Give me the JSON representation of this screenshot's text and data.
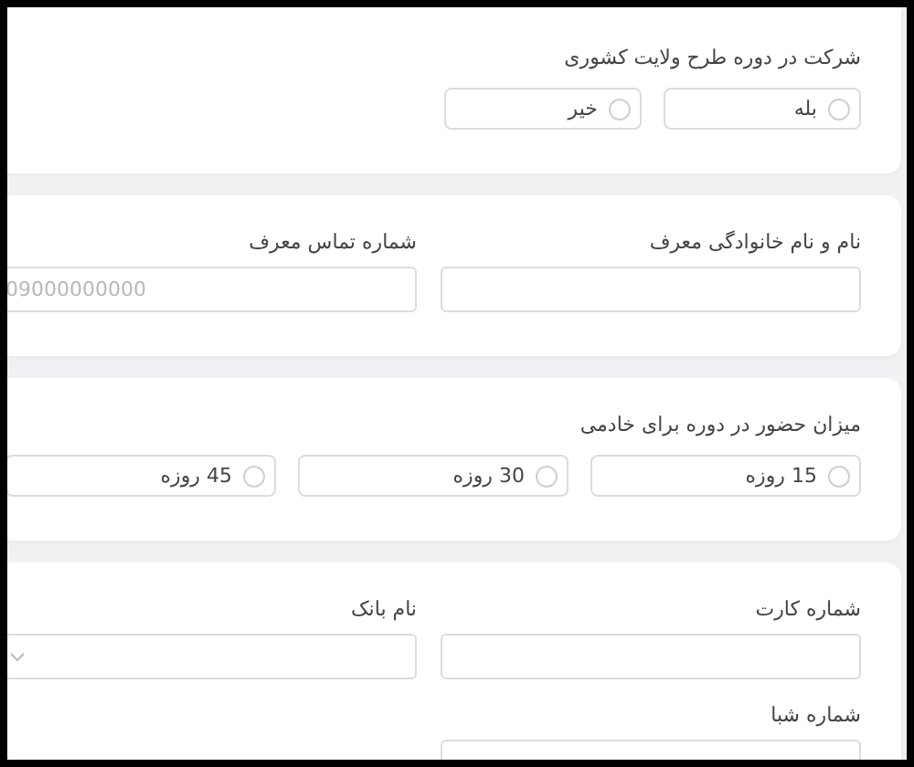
{
  "cards": [
    {
      "kind": "radio",
      "question": "شرکت در دوره طرح ولایت کشوری",
      "options": [
        {
          "label": "بله",
          "selected": false
        },
        {
          "label": "خیر",
          "selected": false
        }
      ]
    },
    {
      "kind": "fields",
      "fields": [
        {
          "kind": "text",
          "label": "نام و نام خانوادگی معرف"
        },
        {
          "kind": "text",
          "label": "شماره تماس معرف",
          "placeholder": "09000000000"
        }
      ]
    },
    {
      "kind": "radio",
      "question": "میزان حضور در دوره برای خادمی",
      "options": [
        {
          "label": "15 روزه",
          "selected": false
        },
        {
          "label": "30 روزه",
          "selected": false
        },
        {
          "label": "45 روزه",
          "selected": false
        }
      ]
    },
    {
      "kind": "fields",
      "fields": [
        {
          "kind": "text",
          "label": "شماره کارت"
        },
        {
          "kind": "select",
          "label": "نام بانک"
        },
        {
          "kind": "text",
          "label": "شماره شبا"
        }
      ]
    }
  ]
}
